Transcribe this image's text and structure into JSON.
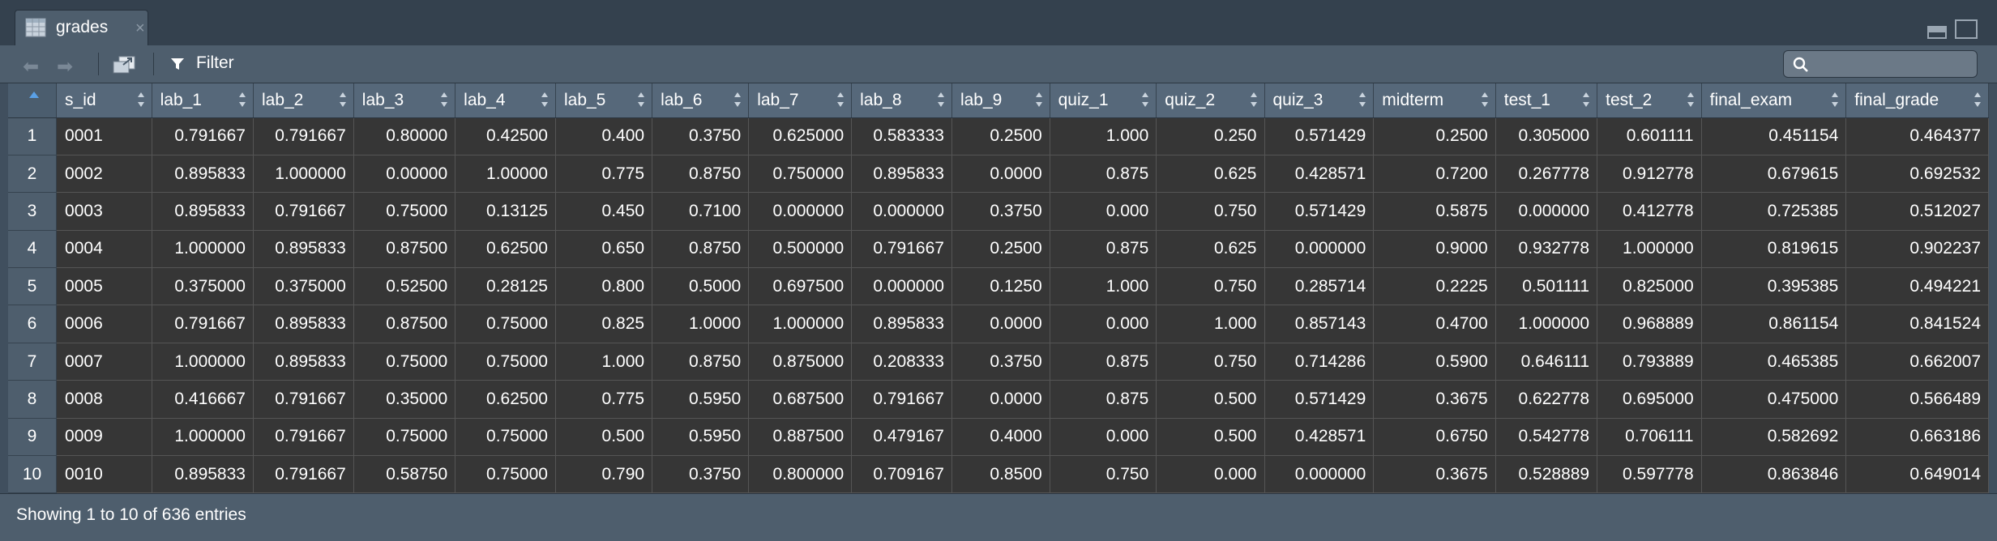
{
  "tab": {
    "label": "grades"
  },
  "toolbar": {
    "filter_label": "Filter",
    "search_placeholder": ""
  },
  "table": {
    "columns": [
      "s_id",
      "lab_1",
      "lab_2",
      "lab_3",
      "lab_4",
      "lab_5",
      "lab_6",
      "lab_7",
      "lab_8",
      "lab_9",
      "quiz_1",
      "quiz_2",
      "quiz_3",
      "midterm",
      "test_1",
      "test_2",
      "final_exam",
      "final_grade"
    ],
    "rows": [
      {
        "n": "1",
        "cells": [
          "0001",
          "0.791667",
          "0.791667",
          "0.80000",
          "0.42500",
          "0.400",
          "0.3750",
          "0.625000",
          "0.583333",
          "0.2500",
          "1.000",
          "0.250",
          "0.571429",
          "0.2500",
          "0.305000",
          "0.601111",
          "0.451154",
          "0.464377"
        ]
      },
      {
        "n": "2",
        "cells": [
          "0002",
          "0.895833",
          "1.000000",
          "0.00000",
          "1.00000",
          "0.775",
          "0.8750",
          "0.750000",
          "0.895833",
          "0.0000",
          "0.875",
          "0.625",
          "0.428571",
          "0.7200",
          "0.267778",
          "0.912778",
          "0.679615",
          "0.692532"
        ]
      },
      {
        "n": "3",
        "cells": [
          "0003",
          "0.895833",
          "0.791667",
          "0.75000",
          "0.13125",
          "0.450",
          "0.7100",
          "0.000000",
          "0.000000",
          "0.3750",
          "0.000",
          "0.750",
          "0.571429",
          "0.5875",
          "0.000000",
          "0.412778",
          "0.725385",
          "0.512027"
        ]
      },
      {
        "n": "4",
        "cells": [
          "0004",
          "1.000000",
          "0.895833",
          "0.87500",
          "0.62500",
          "0.650",
          "0.8750",
          "0.500000",
          "0.791667",
          "0.2500",
          "0.875",
          "0.625",
          "0.000000",
          "0.9000",
          "0.932778",
          "1.000000",
          "0.819615",
          "0.902237"
        ]
      },
      {
        "n": "5",
        "cells": [
          "0005",
          "0.375000",
          "0.375000",
          "0.52500",
          "0.28125",
          "0.800",
          "0.5000",
          "0.697500",
          "0.000000",
          "0.1250",
          "1.000",
          "0.750",
          "0.285714",
          "0.2225",
          "0.501111",
          "0.825000",
          "0.395385",
          "0.494221"
        ]
      },
      {
        "n": "6",
        "cells": [
          "0006",
          "0.791667",
          "0.895833",
          "0.87500",
          "0.75000",
          "0.825",
          "1.0000",
          "1.000000",
          "0.895833",
          "0.0000",
          "0.000",
          "1.000",
          "0.857143",
          "0.4700",
          "1.000000",
          "0.968889",
          "0.861154",
          "0.841524"
        ]
      },
      {
        "n": "7",
        "cells": [
          "0007",
          "1.000000",
          "0.895833",
          "0.75000",
          "0.75000",
          "1.000",
          "0.8750",
          "0.875000",
          "0.208333",
          "0.3750",
          "0.875",
          "0.750",
          "0.714286",
          "0.5900",
          "0.646111",
          "0.793889",
          "0.465385",
          "0.662007"
        ]
      },
      {
        "n": "8",
        "cells": [
          "0008",
          "0.416667",
          "0.791667",
          "0.35000",
          "0.62500",
          "0.775",
          "0.5950",
          "0.687500",
          "0.791667",
          "0.0000",
          "0.875",
          "0.500",
          "0.571429",
          "0.3675",
          "0.622778",
          "0.695000",
          "0.475000",
          "0.566489"
        ]
      },
      {
        "n": "9",
        "cells": [
          "0009",
          "1.000000",
          "0.791667",
          "0.75000",
          "0.75000",
          "0.500",
          "0.5950",
          "0.887500",
          "0.479167",
          "0.4000",
          "0.000",
          "0.500",
          "0.428571",
          "0.6750",
          "0.542778",
          "0.706111",
          "0.582692",
          "0.663186"
        ]
      },
      {
        "n": "10",
        "cells": [
          "0010",
          "0.895833",
          "0.791667",
          "0.58750",
          "0.75000",
          "0.790",
          "0.3750",
          "0.800000",
          "0.709167",
          "0.8500",
          "0.750",
          "0.000",
          "0.000000",
          "0.3675",
          "0.528889",
          "0.597778",
          "0.863846",
          "0.649014"
        ]
      }
    ]
  },
  "status": {
    "text": "Showing 1 to 10 of 636 entries"
  },
  "colors": {
    "header_bg": "#56687a",
    "cell_bg": "#363636",
    "chrome_bg": "#4e5e6d"
  }
}
